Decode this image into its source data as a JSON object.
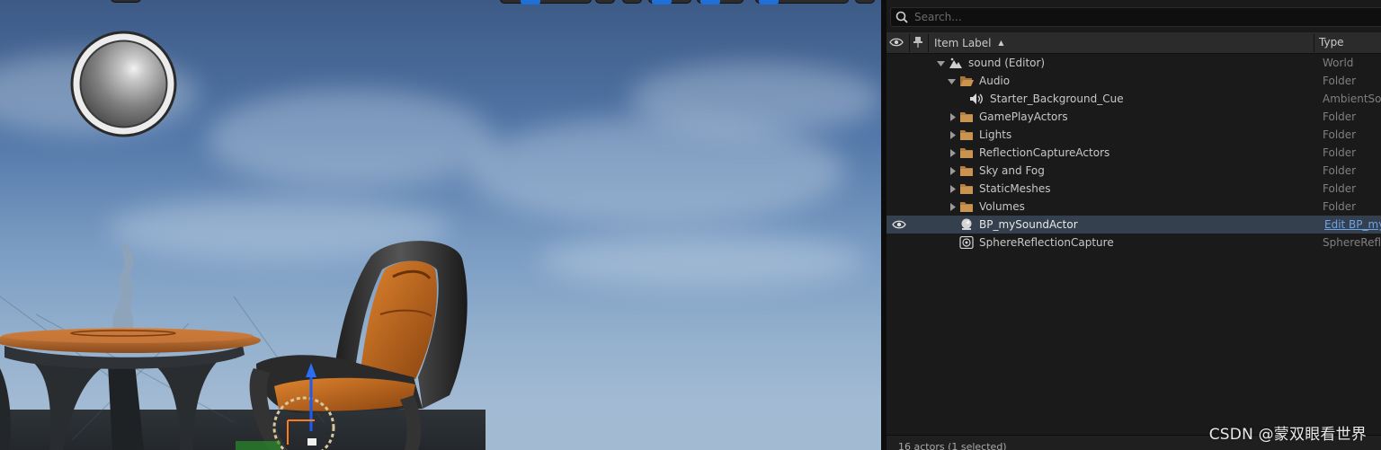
{
  "search": {
    "placeholder": "Search..."
  },
  "columns": {
    "item_label": "Item Label",
    "type": "Type"
  },
  "rows": [
    {
      "label": "sound (Editor)",
      "type": "World",
      "icon": "world-icon",
      "expanded": true
    },
    {
      "label": "Audio",
      "type": "Folder",
      "icon": "folder-open-icon",
      "expanded": true
    },
    {
      "label": "Starter_Background_Cue",
      "type": "AmbientSou",
      "icon": "speaker-icon"
    },
    {
      "label": "GamePlayActors",
      "type": "Folder",
      "icon": "folder-icon",
      "expanded": false
    },
    {
      "label": "Lights",
      "type": "Folder",
      "icon": "folder-icon",
      "expanded": false
    },
    {
      "label": "ReflectionCaptureActors",
      "type": "Folder",
      "icon": "folder-icon",
      "expanded": false
    },
    {
      "label": "Sky and Fog",
      "type": "Folder",
      "icon": "folder-icon",
      "expanded": false
    },
    {
      "label": "StaticMeshes",
      "type": "Folder",
      "icon": "folder-icon",
      "expanded": false
    },
    {
      "label": "Volumes",
      "type": "Folder",
      "icon": "folder-icon",
      "expanded": false
    },
    {
      "label": "BP_mySoundActor",
      "type": "Edit BP_my",
      "icon": "actor-sphere-icon",
      "selected": true
    },
    {
      "label": "SphereReflectionCapture",
      "type": "SphereRefle",
      "icon": "reflection-capture-icon"
    }
  ],
  "status": {
    "text": "16 actors (1 selected)"
  },
  "watermark": {
    "text": "CSDN @蒙双眼看世界"
  },
  "colors": {
    "selected_row": "#34404e",
    "folder": "#c08a4a",
    "link": "#6ea4e8",
    "chair_orange": "#c0661c"
  }
}
